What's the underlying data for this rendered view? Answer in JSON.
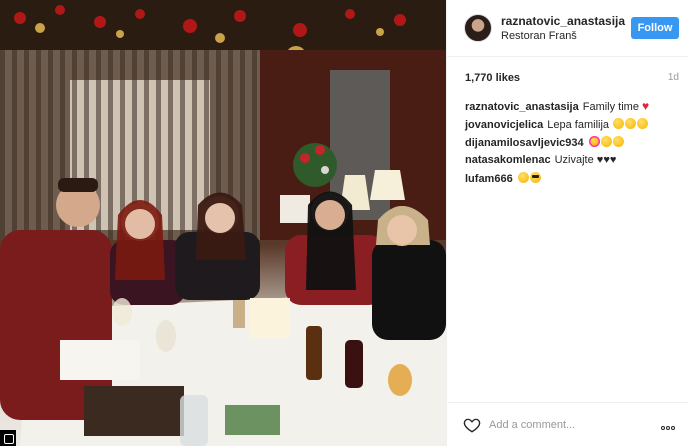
{
  "post": {
    "username": "raznatovic_anastasija",
    "location": "Restoran Franš",
    "follow_label": "Follow",
    "likes": "1,770 likes",
    "time": "1d"
  },
  "comments": [
    {
      "user": "raznatovic_anastasija",
      "text": "Family time",
      "emojis": [
        "heart"
      ]
    },
    {
      "user": "jovanovicjelica",
      "text": "Lepa familija",
      "emojis": [
        "yellow",
        "yellow",
        "yellow"
      ]
    },
    {
      "user": "dijanamilosavljevic934",
      "text": "",
      "emojis": [
        "kiss",
        "yellow",
        "yellow"
      ]
    },
    {
      "user": "natasakomlenac",
      "text": "Uzivajte ♥♥♥",
      "emojis": []
    },
    {
      "user": "lufam666",
      "text": "",
      "emojis": [
        "yellow",
        "cool"
      ]
    }
  ],
  "footer": {
    "comment_placeholder": "Add a comment..."
  },
  "colors": {
    "follow_button": "#3897f0",
    "heart": "#e0263a",
    "text": "#262626",
    "muted": "#999999"
  },
  "icons": {
    "like": "heart-outline-icon",
    "more": "more-options-icon",
    "instagram_corner": "instagram-icon"
  }
}
